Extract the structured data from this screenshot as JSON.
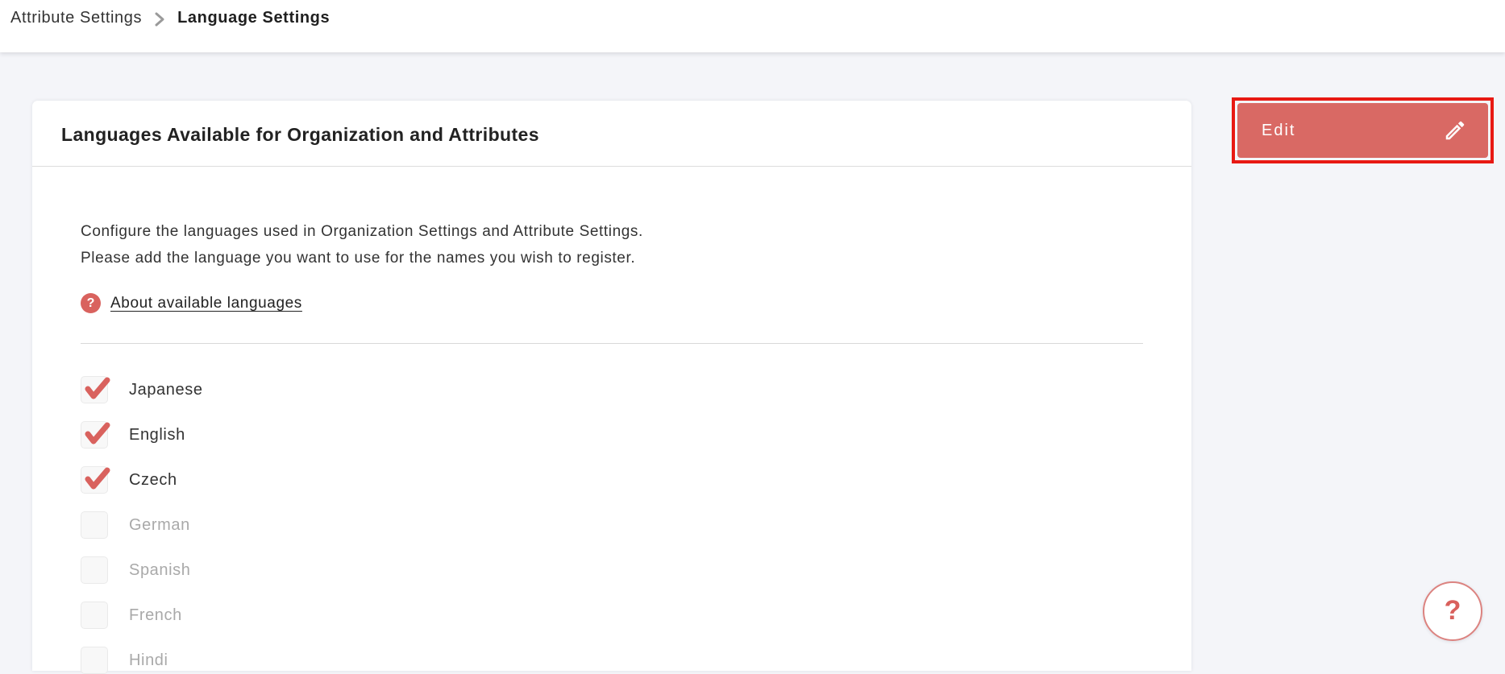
{
  "breadcrumb": {
    "parent": "Attribute Settings",
    "current": "Language Settings"
  },
  "card": {
    "title": "Languages Available for Organization and Attributes",
    "description_line1": "Configure the languages used in Organization Settings and Attribute Settings.",
    "description_line2": "Please add the language you want to use for the names you wish to register.",
    "help_link": "About available languages",
    "help_icon_glyph": "?"
  },
  "edit_button": {
    "label": "Edit",
    "icon": "pencil-icon"
  },
  "languages": [
    {
      "name": "Japanese",
      "checked": true
    },
    {
      "name": "English",
      "checked": true
    },
    {
      "name": "Czech",
      "checked": true
    },
    {
      "name": "German",
      "checked": false
    },
    {
      "name": "Spanish",
      "checked": false
    },
    {
      "name": "French",
      "checked": false
    },
    {
      "name": "Hindi",
      "checked": false
    }
  ],
  "help_fab": {
    "label": "?"
  },
  "colors": {
    "accent_salmon": "#d96964",
    "annotation_red": "#e81913",
    "page_background": "#f4f5f9",
    "card_background": "#ffffff",
    "muted_text": "#a9a9a9",
    "divider": "#d9d9d9"
  }
}
